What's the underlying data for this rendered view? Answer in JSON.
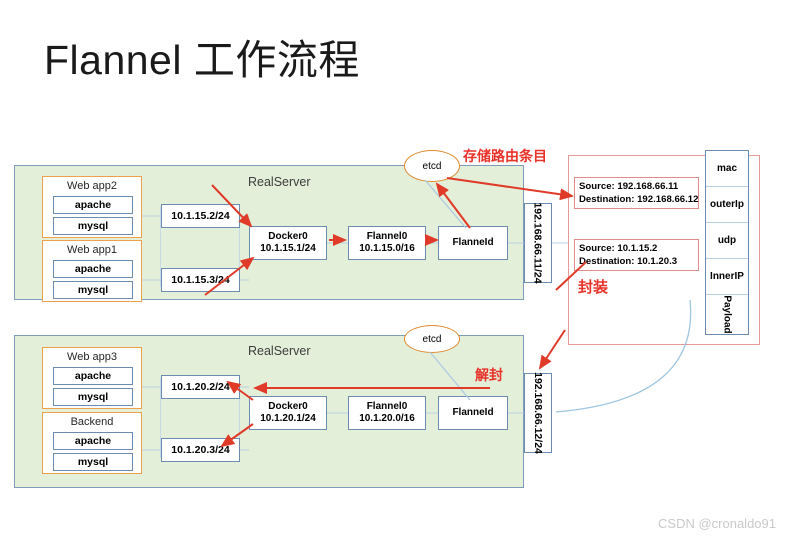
{
  "page": {
    "title": "Flannel 工作流程",
    "watermark": "CSDN @cronaldo91"
  },
  "annotations": {
    "store_route": "存储路由条目",
    "encapsulate": "封装",
    "decapsulate": "解封"
  },
  "top_server": {
    "label": "RealServer",
    "etcd": "etcd",
    "apps": [
      {
        "name": "Web app2",
        "services": [
          "apache",
          "mysql"
        ],
        "ip": "10.1.15.2/24"
      },
      {
        "name": "Web app1",
        "services": [
          "apache",
          "mysql"
        ],
        "ip": "10.1.15.3/24"
      }
    ],
    "docker": {
      "name": "Docker0",
      "cidr": "10.1.15.1/24"
    },
    "flannel": {
      "name": "Flannel0",
      "cidr": "10.1.15.0/16"
    },
    "flanneld": "FlanneId",
    "host_ip": "192.168.66.11/24"
  },
  "bottom_server": {
    "label": "RealServer",
    "etcd": "etcd",
    "apps": [
      {
        "name": "Web app3",
        "services": [
          "apache",
          "mysql"
        ],
        "ip": "10.1.20.2/24"
      },
      {
        "name": "Backend",
        "services": [
          "apache",
          "mysql"
        ],
        "ip": "10.1.20.3/24"
      }
    ],
    "docker": {
      "name": "Docker0",
      "cidr": "10.1.20.1/24"
    },
    "flannel": {
      "name": "Flannel0",
      "cidr": "10.1.20.0/16"
    },
    "flanneld": "FlanneId",
    "host_ip": "192.168.66.12/24"
  },
  "packet": {
    "outer": {
      "source_label": "Source:  192.168.66.11",
      "destination_label": "Destination:  192.168.66.12"
    },
    "inner": {
      "source_label": "Source:  10.1.15.2",
      "destination_label": "Destination:  10.1.20.3"
    },
    "stack": [
      "mac",
      "outerIp",
      "udp",
      "InnerIP",
      "Payload"
    ]
  },
  "colors": {
    "server_fill": "#e3efd9",
    "server_border": "#7f9db9",
    "app_border": "#eda24a",
    "node_border": "#6b8cae",
    "arrow_red": "#e03a28",
    "arc_blue": "#9ec5e0",
    "panel_red": "#e79a9a"
  }
}
